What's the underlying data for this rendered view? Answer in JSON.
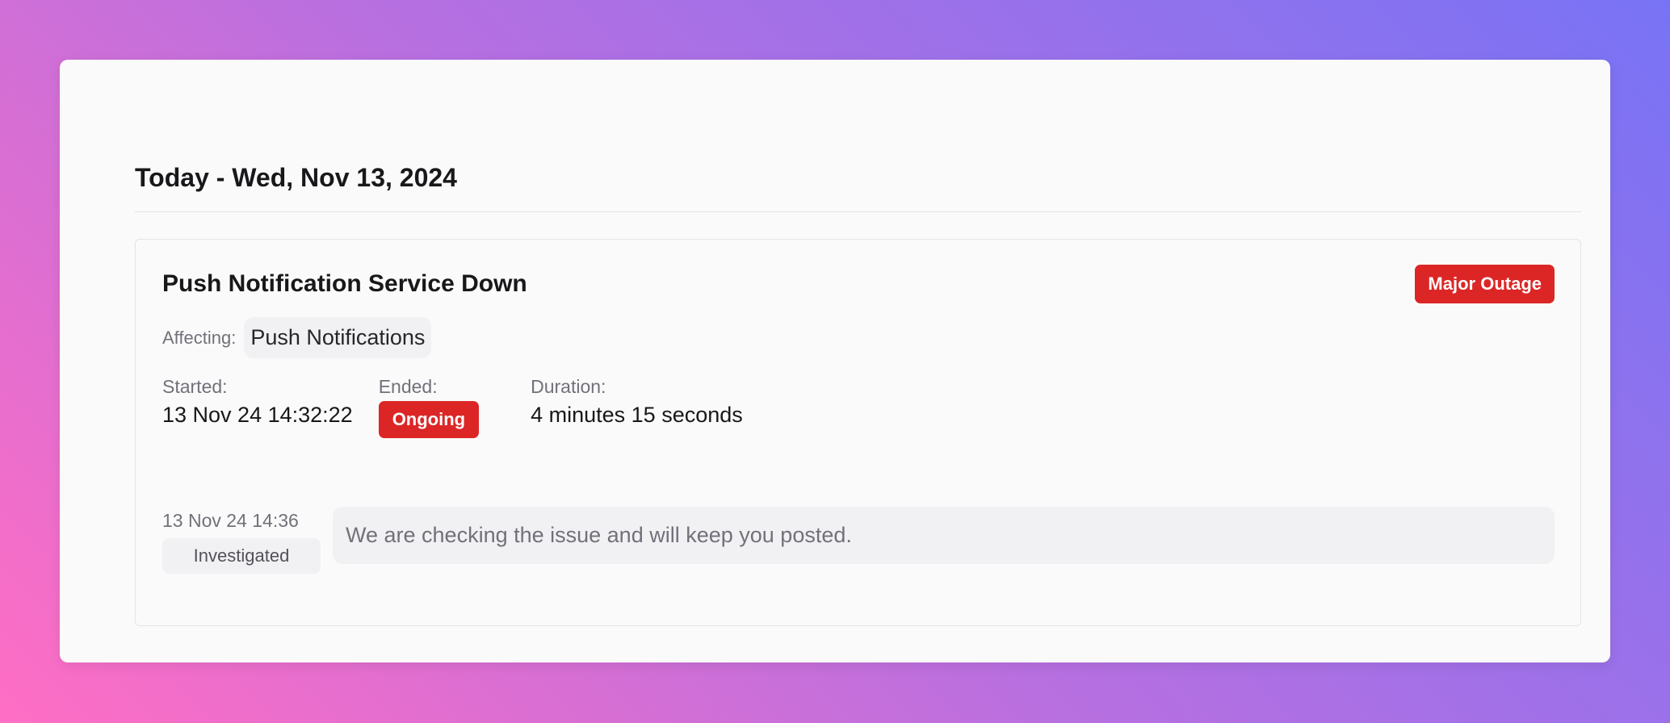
{
  "day": {
    "title": "Today - Wed, Nov 13, 2024"
  },
  "incident": {
    "title": "Push Notification Service Down",
    "severity": "Major Outage",
    "affecting_label": "Affecting:",
    "components": [
      "Push Notifications"
    ],
    "started_label": "Started:",
    "started_value": "13 Nov 24 14:32:22",
    "ended_label": "Ended:",
    "ended_value": "Ongoing",
    "duration_label": "Duration:",
    "duration_value": "4 minutes 15 seconds",
    "updates": [
      {
        "time": "13 Nov 24 14:36",
        "status": "Investigated",
        "message": "We are checking the issue and will keep you posted."
      }
    ]
  },
  "colors": {
    "danger": "#dc2626",
    "chip_bg": "#f1f1f3",
    "muted_text": "#71717a"
  }
}
